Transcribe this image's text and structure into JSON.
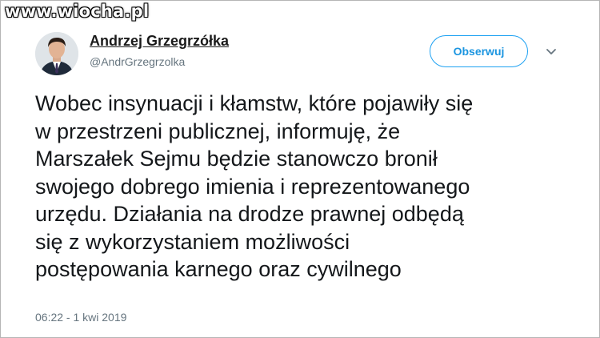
{
  "watermark": "www.wiocha.pl",
  "author": {
    "name": "Andrzej Grzegrzółka",
    "handle": "@AndrGrzegrzolka"
  },
  "follow_label": "Obserwuj",
  "menu_icon": "chevron-down-icon",
  "tweet": {
    "lines": [
      "Wobec insynuacji i kłamstw, które pojawiły się",
      "w przestrzeni publicznej, informuję, że",
      "Marszałek Sejmu będzie stanowczo bronił",
      "swojego dobrego imienia i reprezentowanego",
      "urzędu. Działania na drodze prawnej odbędą",
      "się z wykorzystaniem możliwości",
      "postępowania karnego oraz cywilnego"
    ],
    "timestamp": "06:22 - 1 kwi 2019"
  },
  "colors": {
    "accent": "#1da1f2",
    "text": "#14171a",
    "muted": "#66757f"
  }
}
